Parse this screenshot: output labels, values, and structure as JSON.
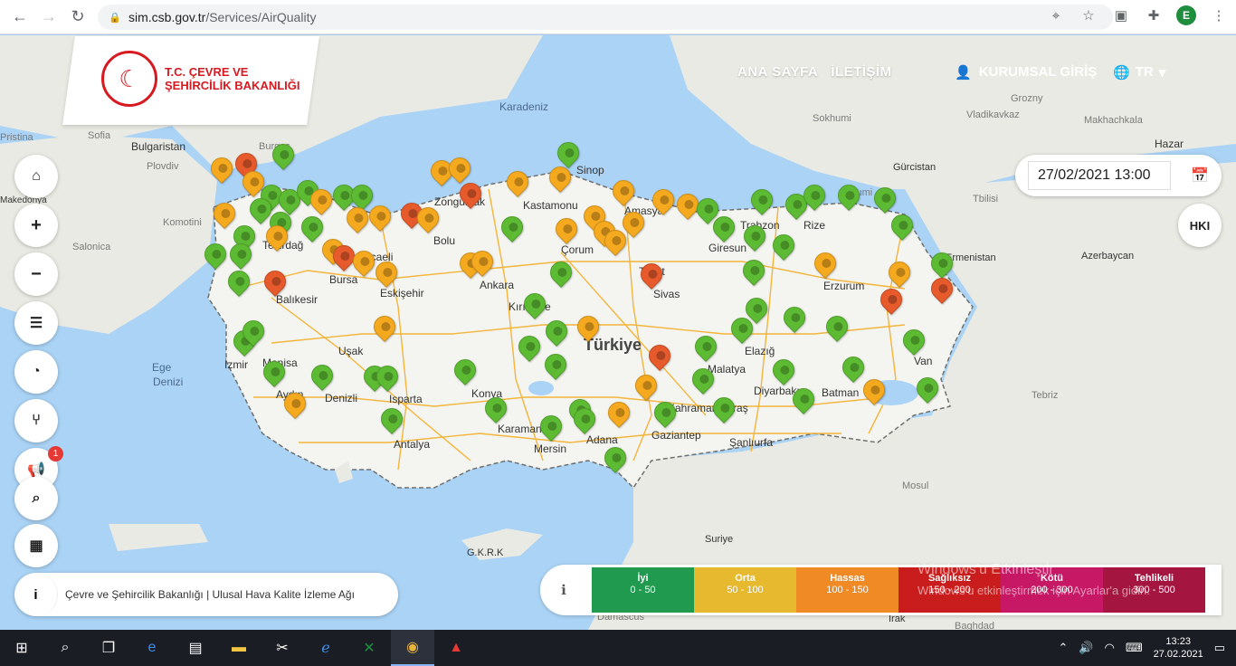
{
  "browser": {
    "url_domain": "sim.csb.gov.tr",
    "url_path": "/Services/AirQuality",
    "profile_initial": "E"
  },
  "logo": {
    "line1": "T.C. ÇEVRE VE",
    "line2": "ŞEHİRCİLİK BAKANLIĞI"
  },
  "nav": {
    "home": "ANA SAYFA",
    "contact": "İLETİŞİM",
    "login": "KURUMSAL GİRİŞ",
    "lang": "TR"
  },
  "date_value": "27/02/2021 13:00",
  "hki_label": "HKI",
  "notification_count": "1",
  "footer_text": "Çevre ve Şehircilik Bakanlığı | Ulusal Hava Kalite İzleme Ağı",
  "legend": [
    {
      "label": "İyi",
      "range": "0 - 50",
      "color": "#1f9a4e"
    },
    {
      "label": "Orta",
      "range": "50 - 100",
      "color": "#e6b92e"
    },
    {
      "label": "Hassas",
      "range": "100 - 150",
      "color": "#ef8a24"
    },
    {
      "label": "Sağlıksız",
      "range": "150 - 200",
      "color": "#c91d1d"
    },
    {
      "label": "Kötü",
      "range": "200 - 300",
      "color": "#c71866"
    },
    {
      "label": "Tehlikeli",
      "range": "300 - 500",
      "color": "#a4163f"
    }
  ],
  "places": {
    "karadeniz": "Karadeniz",
    "bulgaristan": "Bulgaristan",
    "sofia": "Sofia",
    "plovdiv": "Plovdiv",
    "burgas": "Burgas",
    "pristina": "Pristina",
    "makedonya": "Makedonya",
    "ege": "Ege",
    "denizi": "Denizi",
    "sinop": "Sinop",
    "kastamonu": "Kastamonu",
    "zonguldak": "Zonguldak",
    "kocaeli": "Kocaeli",
    "bolu": "Bolu",
    "tekirdag": "Tekirdağ",
    "balikesir": "Balıkesir",
    "bursa": "Bursa",
    "eskisehir": "Eskişehir",
    "ankara": "Ankara",
    "kirikkale": "Kırıkkale",
    "corum": "Çorum",
    "amasya": "Amasya",
    "tokat": "Tokat",
    "sivas": "Sivas",
    "giresun": "Giresun",
    "trabzon": "Trabzon",
    "rize": "Rize",
    "erzurum": "Erzurum",
    "turkiye": "Türkiye",
    "izmir": "İzmir",
    "manisa": "Manisa",
    "usak": "Uşak",
    "aydin": "Aydın",
    "denizli": "Denizli",
    "isparta": "Isparta",
    "konya": "Konya",
    "antalya": "Antalya",
    "karaman": "Karaman",
    "mersin": "Mersin",
    "adana": "Adana",
    "gaziantep": "Gaziantep",
    "kahramanmaras": "Kahramanmaraş",
    "malatya": "Malatya",
    "elazig": "Elazığ",
    "diyarbakir": "Diyarbakır",
    "batman": "Batman",
    "van": "Van",
    "sanliurfa": "Şanlıurfa",
    "gkrk": "G.K.R.K",
    "suriye": "Suriye",
    "irak": "Irak",
    "musul": "Mosul",
    "tebriz": "Tebriz",
    "ermenistan": "Ermenistan",
    "azerbaycan": "Azerbaycan",
    "gurcistan": "Gürcistan",
    "batumi": "Batumi",
    "tbilisi": "Tbilisi",
    "sokhumi": "Sokhumi",
    "grozny": "Grozny",
    "vladikavkaz": "Vladikavkaz",
    "makhachkala": "Makhachkala",
    "hazar": "Hazar",
    "damascus": "Damascus",
    "baghdad": "Baghdad",
    "komotini": "Komotini",
    "salonica": "Salonica"
  },
  "watermark": {
    "line1": "Windows'u Etkinleştir",
    "line2": "Windows'u etkinleştirmek için Ayarlar'a gidin."
  },
  "clock": {
    "time": "13:23",
    "date": "27.02.2021"
  }
}
